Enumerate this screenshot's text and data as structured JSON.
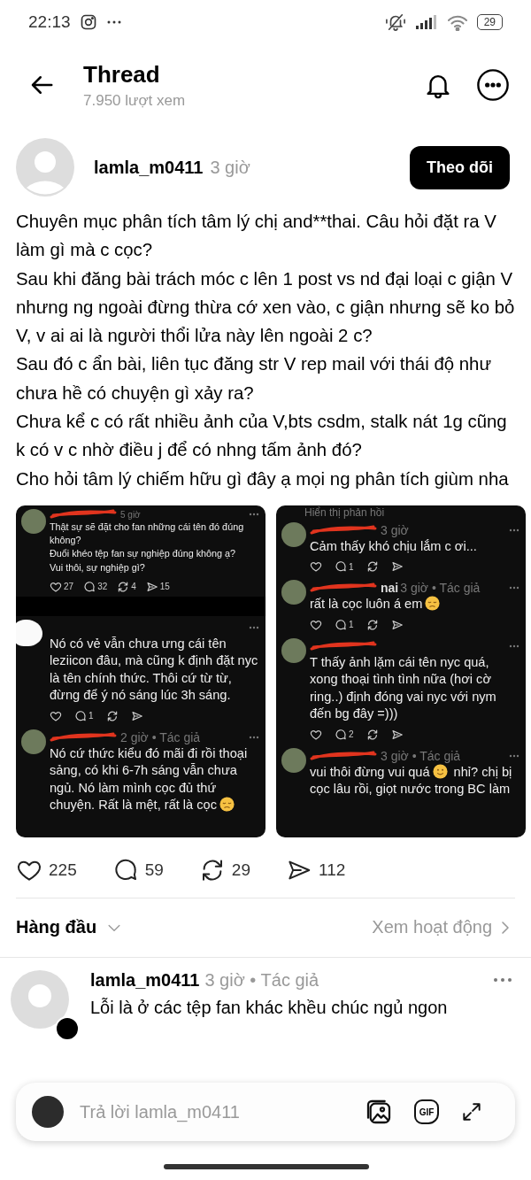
{
  "status_bar": {
    "time": "22:13",
    "battery": "29"
  },
  "header": {
    "title": "Thread",
    "views": "7.950 lượt xem"
  },
  "post": {
    "author": "lamla_m0411",
    "time": "3 giờ",
    "follow_button": "Theo dõi",
    "paragraphs": [
      "Chuyên mục phân tích tâm lý chị and**thai. Câu hỏi đặt ra V làm gì mà c cọc?",
      "Sau khi đăng bài trách móc c lên 1 post vs nd đại loại c giận V nhưng ng ngoài đừng thừa cớ xen vào, c giận nhưng sẽ ko bỏ V, v ai ai là người thổi lửa này lên ngoài 2 c?",
      "Sau đó c ẩn bài, liên tục đăng str V rep mail với thái độ như chưa hề có chuyện gì xảy ra?",
      "Chưa kể c có rất nhiều ảnh của V,bts csdm, stalk nát 1g cũng k có v c nhờ điều j để có nhng tấm ảnh đó?",
      "Cho hỏi tâm lý chiếm hữu gì đây ạ mọi ng phân tích giùm nha"
    ],
    "screenshots": [
      {
        "items": [
          {
            "kind": "comment_compact",
            "username_scribbled": true,
            "meta": "5 giờ",
            "segments": [
              {
                "text": "Thật sự sẽ đặt cho fan những cái tên đó đúng không?\nĐuổi khéo tệp fan sự nghiệp đúng không ạ?\nVui thôi, sự nghiệp gì?"
              }
            ],
            "stats": {
              "like": "27",
              "reply": "32",
              "repost": "4",
              "share": "15"
            }
          },
          {
            "kind": "redaction_bar"
          },
          {
            "kind": "comment",
            "avatar_covered": true,
            "segments": [
              {
                "text": "Nó có vẻ vẫn chưa ưng cái tên leziicon đâu, mà cũng k định đặt nyc là tên chính thức. Thôi cứ từ từ, đừng để ý nó sáng lúc 3h sáng."
              }
            ],
            "stats": {
              "reply": "1"
            }
          },
          {
            "kind": "comment",
            "username_scribbled": true,
            "meta": "2 giờ • Tác giả",
            "segments": [
              {
                "text": "Nó cứ thức kiểu đó mãi đi rồi thoại sảng, có khi 6-7h sáng vẫn chưa ngủ. Nó làm mình cọc đủ thứ chuyện. Rất là mệt, rất là cọc"
              },
              {
                "kind": "sad_emoji"
              }
            ]
          }
        ]
      },
      {
        "items": [
          {
            "kind": "show_replies",
            "text": "Hiển thị phản hồi"
          },
          {
            "kind": "comment",
            "username_scribbled": true,
            "meta": "3 giờ",
            "segments": [
              {
                "text": "Cảm thấy khó chịu lắm c ơi..."
              }
            ],
            "stats": {
              "reply": "1"
            }
          },
          {
            "kind": "comment",
            "username_scribbled": true,
            "username": "nai",
            "meta": "3 giờ • Tác giả",
            "segments": [
              {
                "text": "rất là cọc luôn á em"
              },
              {
                "kind": "sad_emoji"
              }
            ],
            "stats": {
              "reply": "1"
            }
          },
          {
            "kind": "comment",
            "username_scribbled": true,
            "segments": [
              {
                "text": "T thấy ảnh lặm cái tên nyc quá, xong thoại tình tình nữa (hơi cờ ring..) định đóng vai nyc với nym đến bg đây =)))"
              }
            ],
            "stats": {
              "reply": "2"
            }
          },
          {
            "kind": "comment",
            "username_scribbled": true,
            "meta": "3 giờ • Tác giả",
            "segments": [
              {
                "text": "vui thôi đừng vui quá"
              },
              {
                "kind": "smile_emoji"
              },
              {
                "text": "nhỉ? chị bị cọc lâu rồi, giọt nước trong BC làm"
              }
            ]
          }
        ]
      }
    ],
    "stats": {
      "likes": "225",
      "replies": "59",
      "reposts": "29",
      "shares": "112"
    }
  },
  "sort": {
    "label": "Hàng đầu",
    "activity_link": "Xem hoạt động"
  },
  "comment": {
    "author": "lamla_m0411",
    "meta": "3 giờ • Tác giả",
    "text": "Lỗi là ở các tệp fan khác khều chúc ngủ ngon"
  },
  "reply_bar": {
    "placeholder": "Trả lời lamla_m0411",
    "gif": "GIF"
  }
}
